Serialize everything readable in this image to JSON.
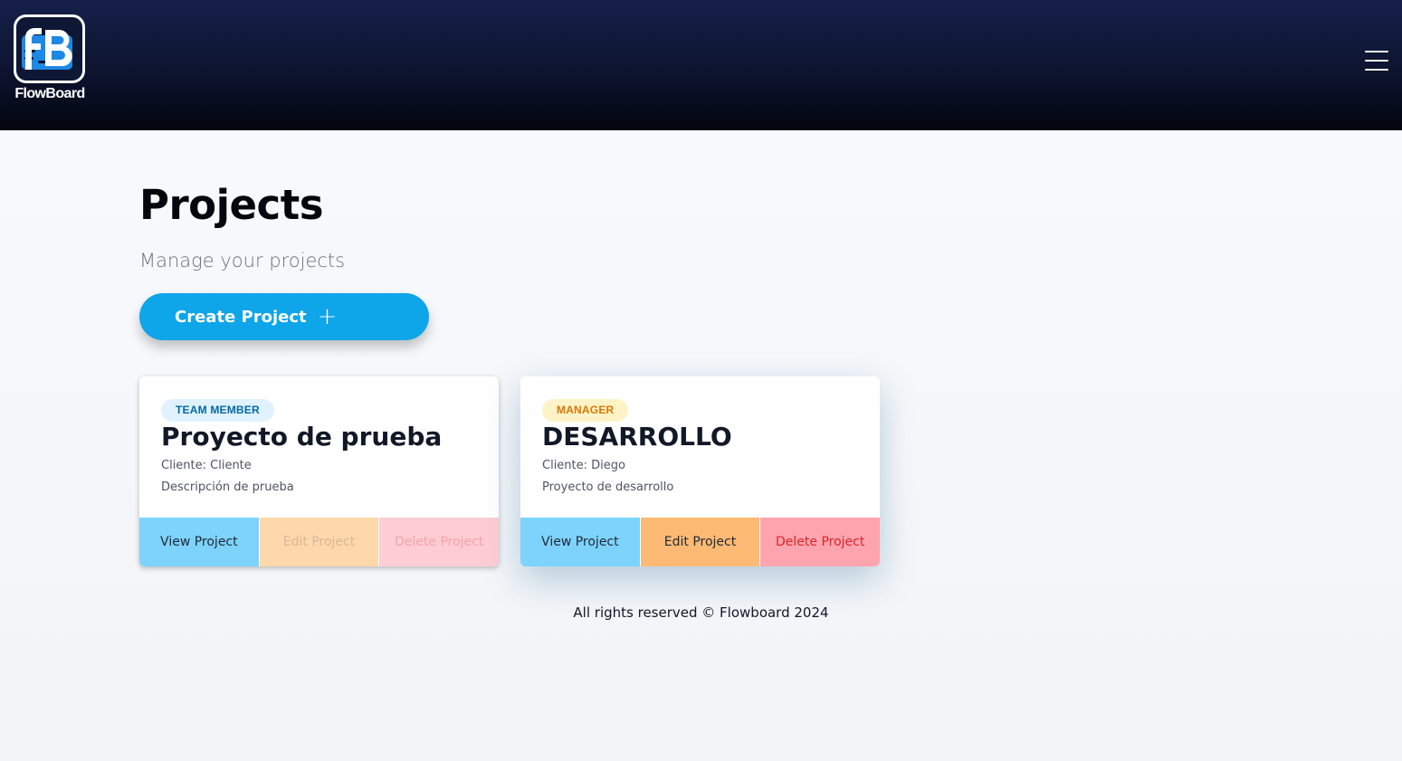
{
  "header": {
    "logo_text": "FlowBoard",
    "menu_icon": "hamburger-menu-icon"
  },
  "main": {
    "title": "Projects",
    "subtitle": "Manage your projects",
    "create_button_label": "Create Project",
    "create_button_icon": "+"
  },
  "projects": [
    {
      "role": "TEAM MEMBER",
      "name": "Proyecto de prueba",
      "client": "Cliente: Cliente",
      "description": "Descripción de prueba",
      "view_label": "View Project",
      "edit_label": "Edit Project",
      "delete_label": "Delete Project",
      "edit_enabled": false,
      "delete_enabled": false
    },
    {
      "role": "MANAGER",
      "name": "DESARROLLO",
      "client": "Cliente: Diego",
      "description": "Proyecto de desarrollo",
      "view_label": "View Project",
      "edit_label": "Edit Project",
      "delete_label": "Delete Project",
      "edit_enabled": true,
      "delete_enabled": true
    }
  ],
  "footer": {
    "text": "All rights reserved © Flowboard 2024"
  },
  "colors": {
    "primary": "#0ea5e9",
    "header_dark": "#03060f",
    "view_button": "#7dd3fc",
    "edit_button": "#fdba74",
    "delete_button": "#fda4af"
  }
}
